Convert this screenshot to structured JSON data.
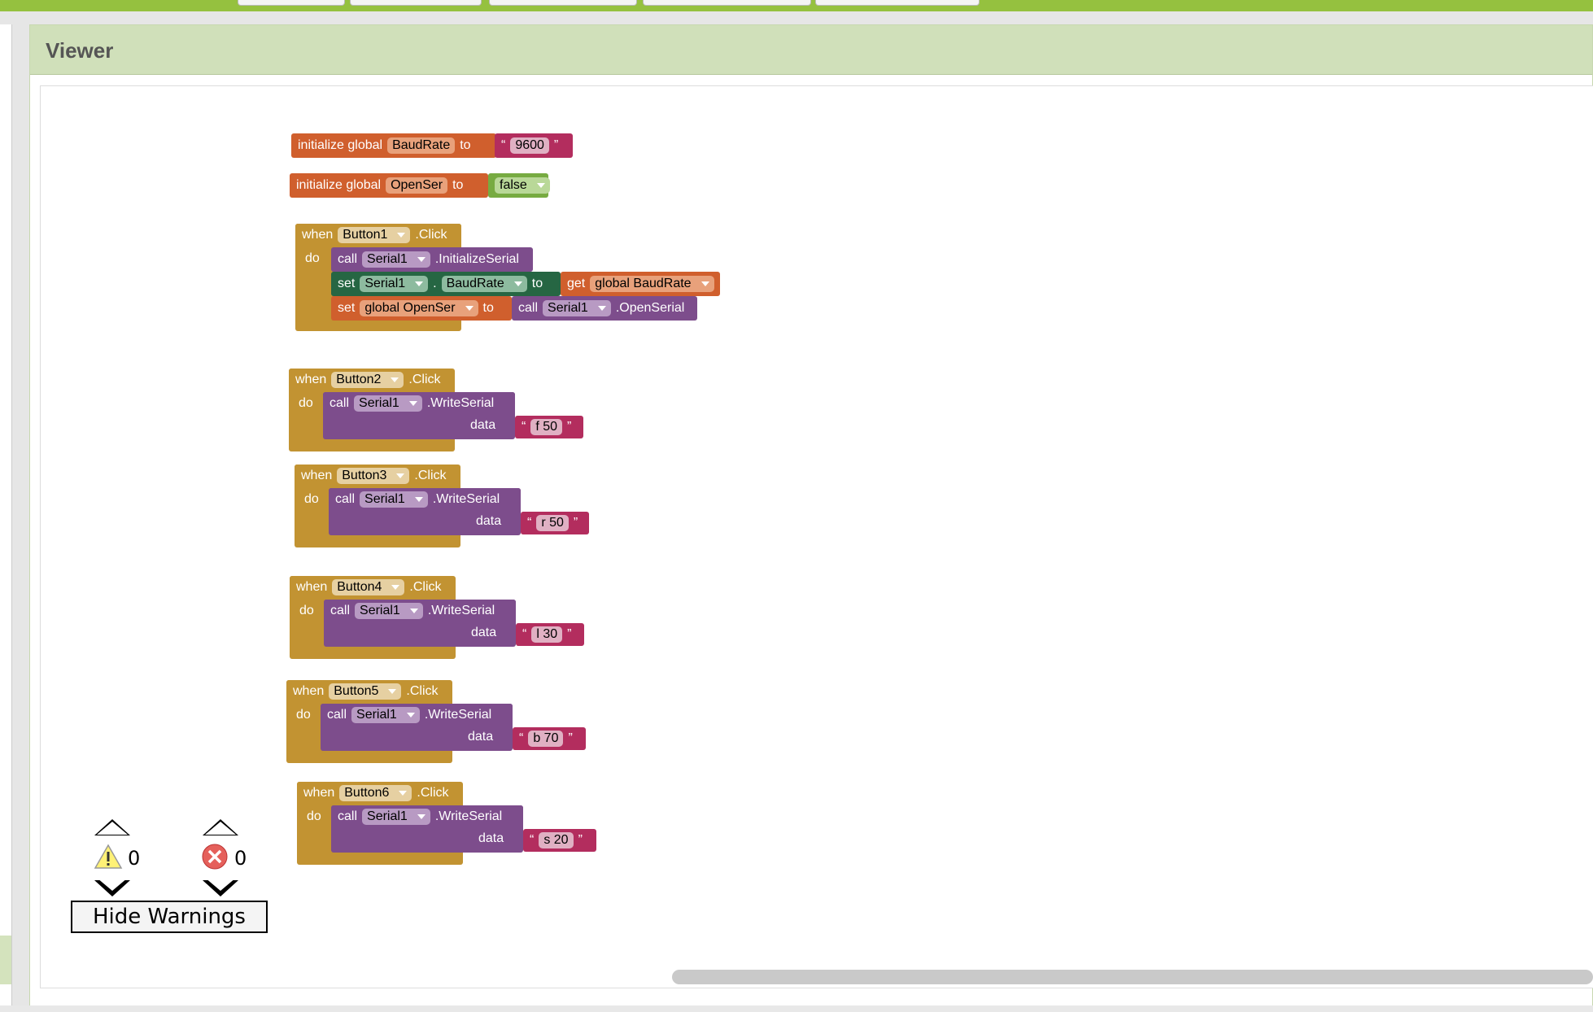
{
  "panel": {
    "title": "Viewer"
  },
  "globals": [
    {
      "prefix": "initialize global",
      "name": "BaudRate",
      "to": "to",
      "value": "9600"
    },
    {
      "prefix": "initialize global",
      "name": "OpenSer",
      "to": "to",
      "value": "false"
    }
  ],
  "button1": {
    "when": "when",
    "component": "Button1",
    "event": ".Click",
    "do": "do",
    "stmt1": {
      "call": "call",
      "component": "Serial1",
      "method": ".InitializeSerial"
    },
    "stmt2": {
      "set": "set",
      "component": "Serial1",
      "dot": ".",
      "property": "BaudRate",
      "to": "to",
      "get": "get",
      "var": "global BaudRate"
    },
    "stmt3": {
      "set": "set",
      "var": "global OpenSer",
      "to": "to",
      "call": "call",
      "component": "Serial1",
      "method": ".OpenSerial"
    }
  },
  "write_events": [
    {
      "when": "when",
      "component": "Button2",
      "event": ".Click",
      "do": "do",
      "call": "call",
      "serial": "Serial1",
      "method": ".WriteSerial",
      "data_label": "data",
      "data": "f 50"
    },
    {
      "when": "when",
      "component": "Button3",
      "event": ".Click",
      "do": "do",
      "call": "call",
      "serial": "Serial1",
      "method": ".WriteSerial",
      "data_label": "data",
      "data": "r 50"
    },
    {
      "when": "when",
      "component": "Button4",
      "event": ".Click",
      "do": "do",
      "call": "call",
      "serial": "Serial1",
      "method": ".WriteSerial",
      "data_label": "data",
      "data": "l 30"
    },
    {
      "when": "when",
      "component": "Button5",
      "event": ".Click",
      "do": "do",
      "call": "call",
      "serial": "Serial1",
      "method": ".WriteSerial",
      "data_label": "data",
      "data": "b 70"
    },
    {
      "when": "when",
      "component": "Button6",
      "event": ".Click",
      "do": "do",
      "call": "call",
      "serial": "Serial1",
      "method": ".WriteSerial",
      "data_label": "data",
      "data": "s 20"
    }
  ],
  "warnings": {
    "count": "0",
    "icon": "warning-triangle-icon"
  },
  "errors": {
    "count": "0",
    "icon": "error-circle-icon"
  },
  "hide_warnings_label": "Hide Warnings",
  "quote_open": "“",
  "quote_close": "”",
  "colors": {
    "topbar": "#95c13f",
    "header": "#d0e0ba",
    "variable_block": "#d05f2d",
    "text_block": "#b32d5e",
    "logic_block": "#77ab41",
    "event_block": "#c29332",
    "component_method_block": "#7d4d8c",
    "component_setter_block": "#266643"
  }
}
